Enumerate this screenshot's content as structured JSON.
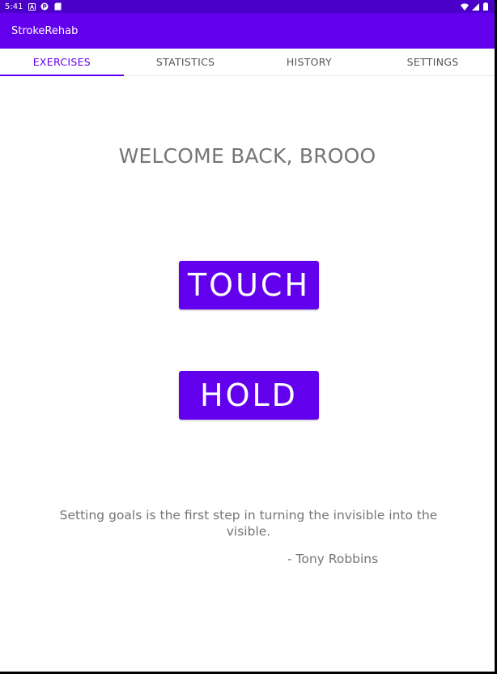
{
  "status_bar": {
    "time": "5:41",
    "left_icons": [
      "a-icon",
      "p-icon",
      "sd-card-icon"
    ],
    "right_icons": [
      "wifi-icon",
      "signal-icon",
      "battery-icon"
    ]
  },
  "app_bar": {
    "title": "StrokeRehab"
  },
  "tabs": [
    {
      "label": "EXERCISES",
      "active": true
    },
    {
      "label": "STATISTICS",
      "active": false
    },
    {
      "label": "HISTORY",
      "active": false
    },
    {
      "label": "SETTINGS",
      "active": false
    }
  ],
  "main": {
    "welcome": "WELCOME BACK, BROOO",
    "touch_button": "TOUCH",
    "hold_button": "HOLD",
    "quote": "Setting goals is the first step in turning the invisible into the visible.",
    "author": "- Tony Robbins"
  },
  "colors": {
    "primary": "#6200ee",
    "status_bar": "#4a00c8",
    "text_gray": "#757575"
  }
}
